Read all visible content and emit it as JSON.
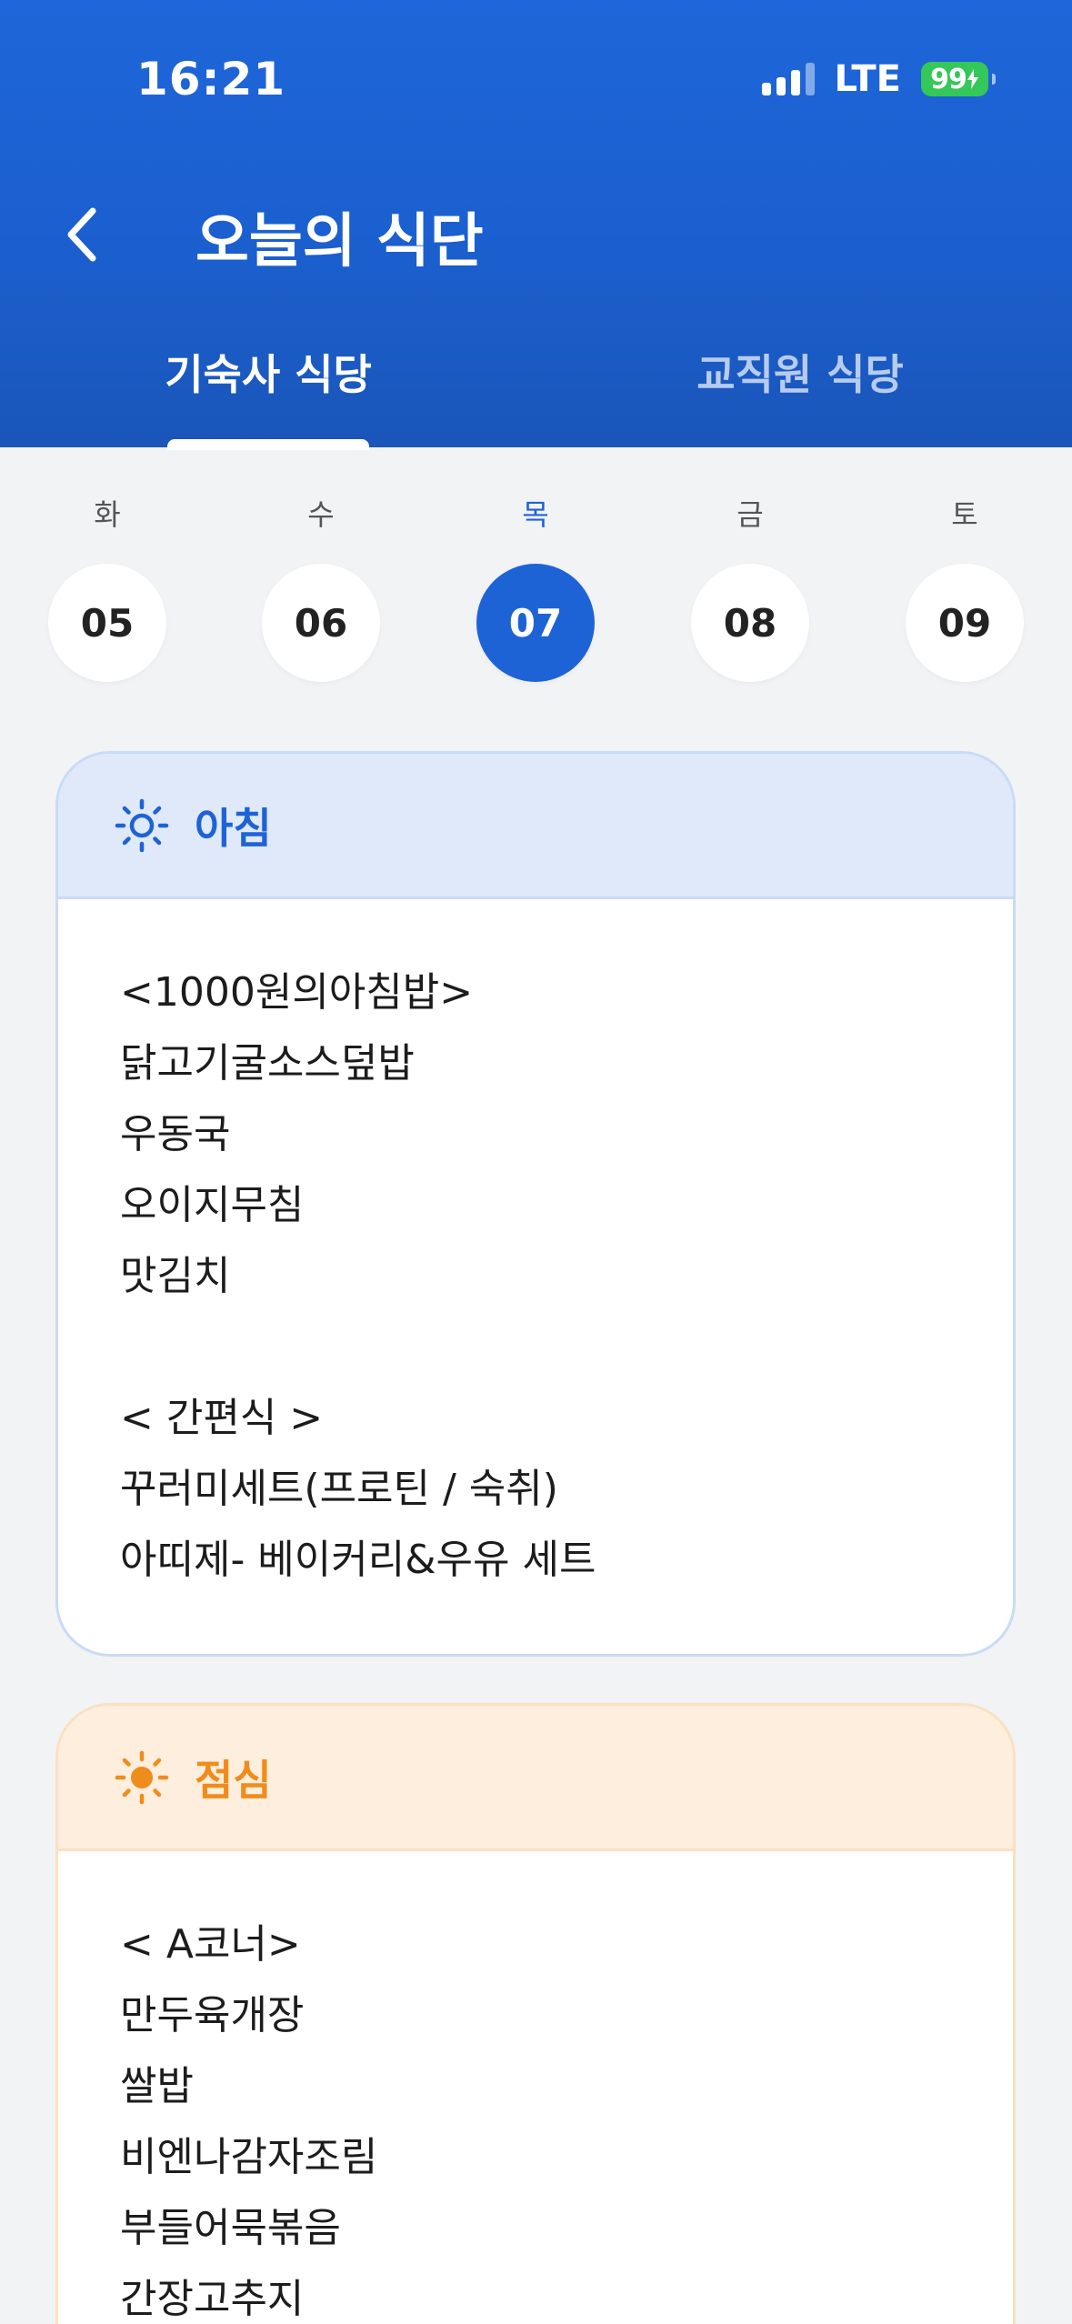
{
  "status_bar": {
    "time": "16:21",
    "network": "LTE",
    "battery": "99"
  },
  "header": {
    "title": "오늘의 식단"
  },
  "tabs": [
    {
      "label": "기숙사 식당",
      "active": true
    },
    {
      "label": "교직원 식당",
      "active": false
    }
  ],
  "days": [
    {
      "weekday": "화",
      "date": "05",
      "selected": false
    },
    {
      "weekday": "수",
      "date": "06",
      "selected": false
    },
    {
      "weekday": "목",
      "date": "07",
      "selected": true
    },
    {
      "weekday": "금",
      "date": "08",
      "selected": false
    },
    {
      "weekday": "토",
      "date": "09",
      "selected": false
    }
  ],
  "meals": {
    "breakfast": {
      "title": "아침",
      "icon": "sun-outline-icon",
      "accent": "#1e63d6",
      "items": [
        "<1000원의아침밥>",
        "닭고기굴소스덮밥",
        "우동국",
        "오이지무침",
        "맛김치",
        "",
        "< 간편식 >",
        "꾸러미세트(프로틴 / 숙취)",
        "아띠제- 베이커리&우유 세트"
      ]
    },
    "lunch": {
      "title": "점심",
      "icon": "sun-filled-icon",
      "accent": "#f08c1b",
      "items": [
        "< A코너>",
        "만두육개장",
        "쌀밥",
        "비엔나감자조림",
        "부들어묵볶음",
        "간장고추지"
      ]
    }
  },
  "colors": {
    "header": "#1b5fcf",
    "selected_day": "#1e63d6",
    "background": "#f2f3f5"
  }
}
